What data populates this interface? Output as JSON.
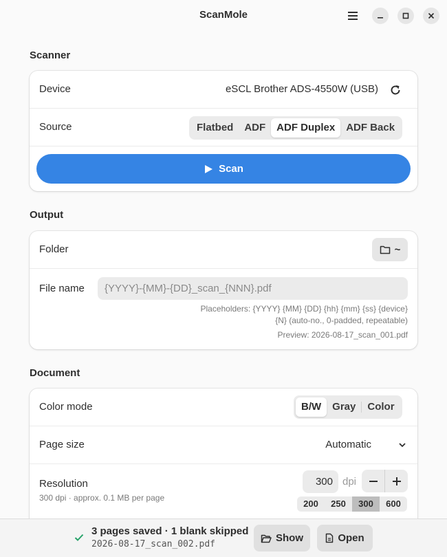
{
  "window": {
    "title": "ScanMole"
  },
  "scanner": {
    "section_title": "Scanner",
    "device_label": "Device",
    "device_value": "eSCL Brother ADS-4550W (USB)",
    "source_label": "Source",
    "sources": [
      "Flatbed",
      "ADF",
      "ADF Duplex",
      "ADF Back"
    ],
    "selected_source": "ADF Duplex",
    "scan_label": "Scan"
  },
  "output": {
    "section_title": "Output",
    "folder_label": "Folder",
    "folder_value": "~",
    "filename_label": "File name",
    "filename_placeholder": "{YYYY}-{MM}-{DD}_scan_{NNN}.pdf",
    "placeholders_line1": "Placeholders: {YYYY} {MM} {DD} {hh} {mm} {ss} {device}",
    "placeholders_line2": "{N} (auto-no., 0-padded, repeatable)",
    "preview": "Preview: 2026-08-17_scan_001.pdf"
  },
  "document": {
    "section_title": "Document",
    "color_label": "Color mode",
    "color_modes": [
      "B/W",
      "Gray",
      "Color"
    ],
    "selected_color": "B/W",
    "page_size_label": "Page size",
    "page_size_value": "Automatic",
    "resolution_label": "Resolution",
    "resolution_sub": "300 dpi · approx. 0.1 MB per page",
    "resolution_value": "300",
    "resolution_unit": "dpi",
    "presets": [
      "200",
      "250",
      "300",
      "600"
    ],
    "selected_preset": "300"
  },
  "status": {
    "message": "3 pages saved · 1 blank skipped",
    "filename": "2026-08-17_scan_002.pdf",
    "show_label": "Show",
    "open_label": "Open"
  },
  "colors": {
    "accent": "#3584e4",
    "success": "#26a269"
  }
}
